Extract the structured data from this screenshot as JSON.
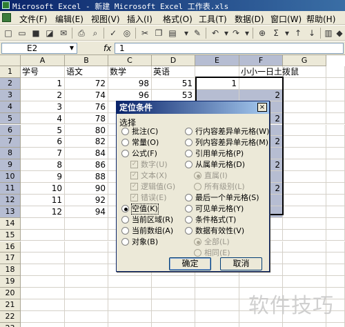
{
  "window": {
    "title": "Microsoft Excel - 新建 Microsoft Excel 工作表.xls"
  },
  "menu": [
    "文件(F)",
    "编辑(E)",
    "视图(V)",
    "插入(I)",
    "格式(O)",
    "工具(T)",
    "数据(D)",
    "窗口(W)",
    "帮助(H)"
  ],
  "toolbar": {
    "sigma": "Σ"
  },
  "formula_bar": {
    "name_box": "E2",
    "fx": "fx",
    "value": "1"
  },
  "columns": [
    "A",
    "B",
    "C",
    "D",
    "E",
    "F",
    "G"
  ],
  "rows": [
    "1",
    "2",
    "3",
    "4",
    "5",
    "6",
    "7",
    "8",
    "9",
    "10",
    "11",
    "12",
    "13",
    "14",
    "15",
    "16",
    "17",
    "18",
    "19",
    "20",
    "21",
    "22",
    "23"
  ],
  "sheet": {
    "headers": {
      "a": "学号",
      "b": "语文",
      "c": "数学",
      "d": "英语",
      "f": "小小一日土拨鼠"
    },
    "col_a": [
      "1",
      "2",
      "3",
      "4",
      "5",
      "6",
      "7",
      "8",
      "9",
      "10",
      "11",
      "12"
    ],
    "col_b": [
      "72",
      "74",
      "76",
      "78",
      "80",
      "82",
      "84",
      "86",
      "88",
      "90",
      "92",
      "94"
    ],
    "col_c": [
      "98",
      "96"
    ],
    "col_d": [
      "51",
      "53"
    ],
    "e2": "1",
    "f_values": [
      "2",
      "2",
      "2",
      "2",
      "2"
    ]
  },
  "dialog": {
    "title": "定位条件",
    "close": "×",
    "group_label": "选择",
    "left_options": [
      {
        "label": "批注(C)",
        "state": "off"
      },
      {
        "label": "常量(O)",
        "state": "off"
      },
      {
        "label": "公式(F)",
        "state": "off"
      }
    ],
    "sub_checks": [
      "数字(U)",
      "文本(X)",
      "逻辑值(G)",
      "错误(E)"
    ],
    "left_options2": [
      {
        "label": "空值(K)",
        "state": "on"
      },
      {
        "label": "当前区域(R)",
        "state": "off"
      },
      {
        "label": "当前数组(A)",
        "state": "off"
      },
      {
        "label": "对象(B)",
        "state": "off"
      }
    ],
    "right_options": [
      {
        "label": "行内容差异单元格(W)"
      },
      {
        "label": "列内容差异单元格(M)"
      },
      {
        "label": "引用单元格(P)"
      },
      {
        "label": "从属单元格(D)"
      }
    ],
    "right_sub1": [
      "直属(I)",
      "所有级别(L)"
    ],
    "right_options2": [
      {
        "label": "最后一个单元格(S)"
      },
      {
        "label": "可见单元格(Y)"
      },
      {
        "label": "条件格式(T)"
      },
      {
        "label": "数据有效性(V)"
      }
    ],
    "right_sub2": [
      "全部(L)",
      "相同(E)"
    ],
    "ok_label": "确定",
    "cancel_label": "取消"
  },
  "watermark": "软件技巧",
  "colors": {
    "title_bar": "#0a246a",
    "selection": "#b6bdd2",
    "arrow": "#f5f020"
  }
}
